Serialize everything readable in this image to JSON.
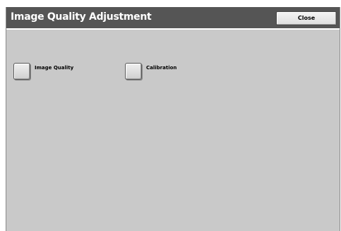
{
  "window": {
    "title": "Image Quality Adjustment",
    "close_label": "Close"
  },
  "options": [
    {
      "label": "Image Quality",
      "checked": false
    },
    {
      "label": "Calibration",
      "checked": false
    }
  ]
}
